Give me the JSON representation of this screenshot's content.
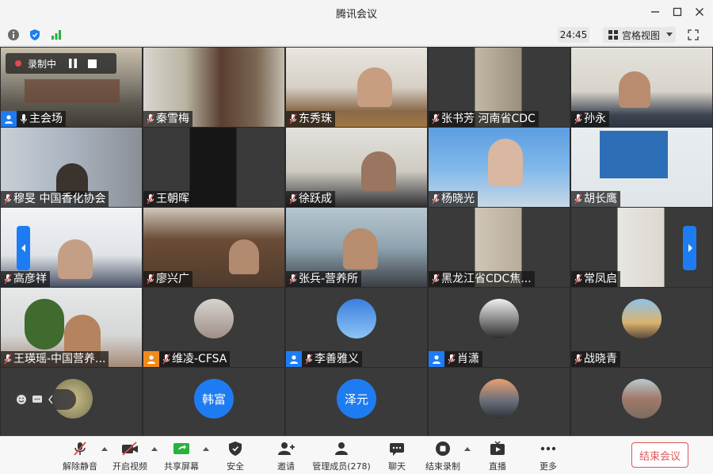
{
  "window": {
    "title": "腾讯会议"
  },
  "toolbar": {
    "timer": "24:45",
    "view_label": "宫格视图"
  },
  "recording": {
    "label": "录制中"
  },
  "tiles": [
    {
      "name": "主会场",
      "type": "video"
    },
    {
      "name": "秦雪梅",
      "type": "video"
    },
    {
      "name": "东秀珠",
      "type": "video"
    },
    {
      "name": "张书芳 河南省CDC",
      "type": "video"
    },
    {
      "name": "孙永",
      "type": "video"
    },
    {
      "name": "穆旻 中国香化协会",
      "type": "video"
    },
    {
      "name": "王朝晖",
      "type": "video"
    },
    {
      "name": "徐跃成",
      "type": "video"
    },
    {
      "name": "杨晓光",
      "type": "video"
    },
    {
      "name": "胡长鹰",
      "type": "video"
    },
    {
      "name": "高彦祥",
      "type": "video"
    },
    {
      "name": "廖兴广",
      "type": "video"
    },
    {
      "name": "张兵-营养所",
      "type": "video"
    },
    {
      "name": "黑龙江省CDC焦...",
      "type": "video"
    },
    {
      "name": "常凤启",
      "type": "video"
    },
    {
      "name": "王瑛瑶-中国营养...",
      "type": "video"
    },
    {
      "name": "维凌-CFSA",
      "type": "avatar"
    },
    {
      "name": "李善雅义",
      "type": "avatar"
    },
    {
      "name": "肖潇",
      "type": "avatar"
    },
    {
      "name": "战晓青",
      "type": "avatar"
    },
    {
      "name": "",
      "type": "avatar"
    },
    {
      "avatar_text": "韩富",
      "type": "avatar-text"
    },
    {
      "avatar_text": "泽元",
      "type": "avatar-text"
    },
    {
      "name": "",
      "type": "avatar"
    },
    {
      "name": "",
      "type": "avatar"
    }
  ],
  "bottombar": {
    "items": [
      {
        "label": "解除静音",
        "icon": "mic-muted-icon"
      },
      {
        "label": "开启视频",
        "icon": "camera-off-icon"
      },
      {
        "label": "共享屏幕",
        "icon": "share-screen-icon"
      },
      {
        "label": "安全",
        "icon": "shield-icon"
      },
      {
        "label": "邀请",
        "icon": "invite-icon"
      },
      {
        "label": "管理成员(278)",
        "icon": "members-icon"
      },
      {
        "label": "聊天",
        "icon": "chat-icon"
      },
      {
        "label": "结束录制",
        "icon": "stop-record-icon"
      },
      {
        "label": "直播",
        "icon": "live-icon"
      },
      {
        "label": "更多",
        "icon": "more-icon"
      }
    ],
    "end_label": "结束会议"
  },
  "colors": {
    "accent": "#1e7cf2",
    "danger": "#e05656",
    "tile_bg": "#2b2b2b"
  }
}
